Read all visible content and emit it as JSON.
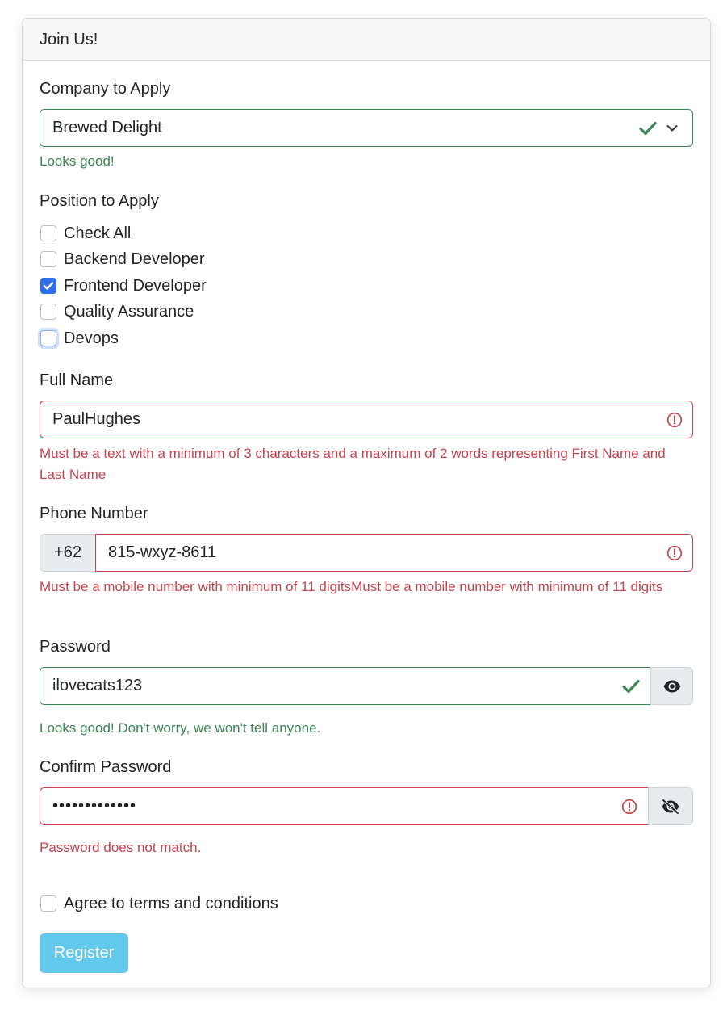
{
  "card": {
    "title": "Join Us!"
  },
  "company": {
    "label": "Company to Apply",
    "selected": "Brewed Delight",
    "feedback": "Looks good!"
  },
  "position": {
    "label": "Position to Apply",
    "options": [
      {
        "label": "Check All",
        "checked": false
      },
      {
        "label": "Backend Developer",
        "checked": false
      },
      {
        "label": "Frontend Developer",
        "checked": true
      },
      {
        "label": "Quality Assurance",
        "checked": false
      },
      {
        "label": "Devops",
        "checked": false,
        "focused": true
      }
    ]
  },
  "full_name": {
    "label": "Full Name",
    "value": "PaulHughes",
    "feedback": "Must be a text with a minimum of 3 characters and a maximum of 2 words representing First Name and Last Name"
  },
  "phone": {
    "label": "Phone Number",
    "prefix": "+62",
    "value": "815-wxyz-8611",
    "feedback": "Must be a mobile number with minimum of 11 digitsMust be a mobile number with minimum of 11 digits"
  },
  "password": {
    "label": "Password",
    "value": "ilovecats123",
    "feedback": "Looks good! Don't worry, we won't tell anyone."
  },
  "confirm_password": {
    "label": "Confirm Password",
    "value": "•••••••••••••",
    "feedback": "Password does not match."
  },
  "terms": {
    "label": "Agree to terms and conditions",
    "checked": false
  },
  "register": {
    "label": "Register"
  },
  "colors": {
    "valid": "#3d8654",
    "invalid": "#c7434d",
    "checkbox_checked": "#2f6fea",
    "button": "#62c8ec"
  }
}
